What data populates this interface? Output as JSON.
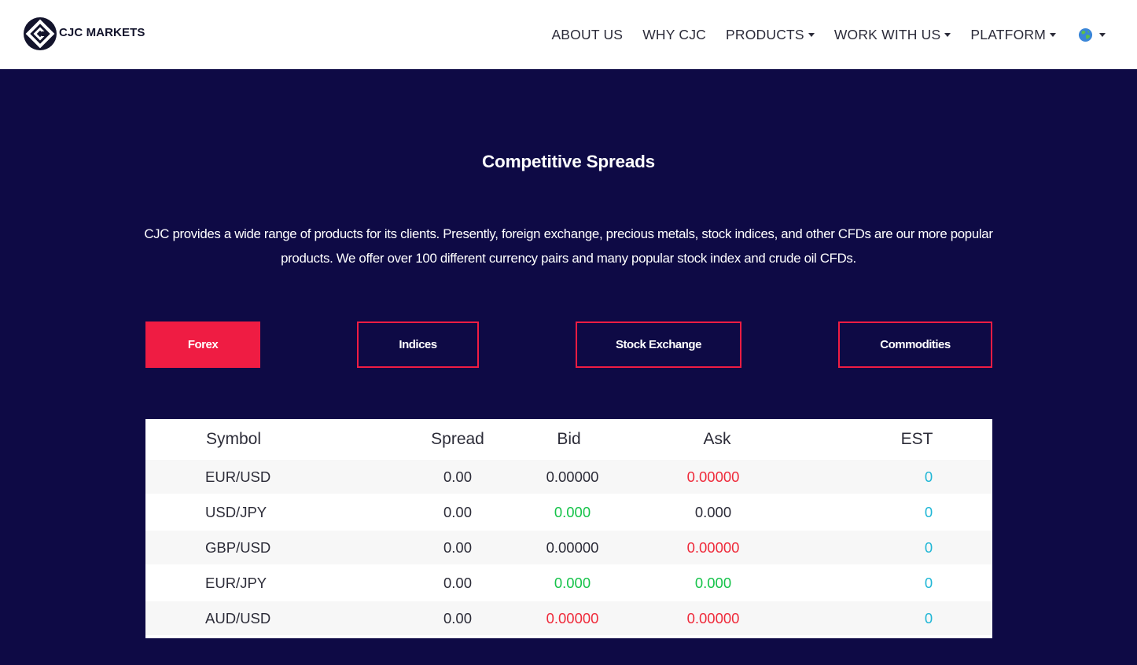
{
  "brand": {
    "name": "CJC MARKETS",
    "logo_icon": "cjc-diamond-logo-icon"
  },
  "nav": {
    "items": [
      {
        "label": "ABOUT US",
        "dropdown": false
      },
      {
        "label": "WHY CJC",
        "dropdown": false
      },
      {
        "label": "PRODUCTS",
        "dropdown": true
      },
      {
        "label": "WORK WITH US",
        "dropdown": true
      },
      {
        "label": "PLATFORM",
        "dropdown": true
      }
    ],
    "language_icon": "globe-icon"
  },
  "hero": {
    "title": "Competitive Spreads",
    "description": "CJC provides a wide range of products for its clients. Presently, foreign exchange, precious metals, stock indices, and other CFDs are our more popular products. We offer over 100 different currency pairs and many popular stock index and crude oil CFDs."
  },
  "tabs": [
    {
      "label": "Forex",
      "active": true
    },
    {
      "label": "Indices",
      "active": false
    },
    {
      "label": "Stock Exchange",
      "active": false
    },
    {
      "label": "Commodities",
      "active": false
    }
  ],
  "table": {
    "headers": [
      "Symbol",
      "Spread",
      "Bid",
      "Ask",
      "EST"
    ],
    "rows": [
      {
        "symbol": "EUR/USD",
        "spread": "0.00",
        "bid": "0.00000",
        "bid_color": "neutral",
        "ask": "0.00000",
        "ask_color": "red",
        "est": "0"
      },
      {
        "symbol": "USD/JPY",
        "spread": "0.00",
        "bid": "0.000",
        "bid_color": "green",
        "ask": "0.000",
        "ask_color": "neutral",
        "est": "0"
      },
      {
        "symbol": "GBP/USD",
        "spread": "0.00",
        "bid": "0.00000",
        "bid_color": "neutral",
        "ask": "0.00000",
        "ask_color": "red",
        "est": "0"
      },
      {
        "symbol": "EUR/JPY",
        "spread": "0.00",
        "bid": "0.000",
        "bid_color": "green",
        "ask": "0.000",
        "ask_color": "green",
        "est": "0"
      },
      {
        "symbol": "AUD/USD",
        "spread": "0.00",
        "bid": "0.00000",
        "bid_color": "red",
        "ask": "0.00000",
        "ask_color": "red",
        "est": "0"
      }
    ]
  },
  "colors": {
    "background": "#0e0a45",
    "accent": "#ef1c43",
    "up": "#16c34a",
    "down": "#ef2b3b",
    "est": "#21b7d6"
  }
}
